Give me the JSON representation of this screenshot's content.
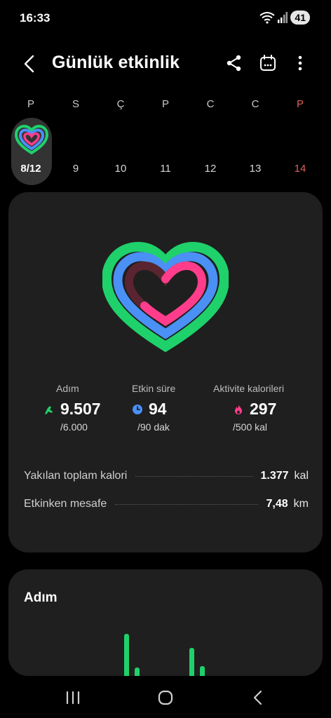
{
  "status_bar": {
    "time": "16:33",
    "battery": "41",
    "icons": [
      "wifi-icon",
      "signal-icon"
    ]
  },
  "app_bar": {
    "title": "Günlük etkinlik",
    "actions": [
      "back-icon",
      "share-icon",
      "calendar-icon",
      "more-vert-icon"
    ]
  },
  "week": {
    "days": [
      {
        "name": "P",
        "num": "8/12",
        "selected": true
      },
      {
        "name": "S",
        "num": "9"
      },
      {
        "name": "Ç",
        "num": "10"
      },
      {
        "name": "P",
        "num": "11"
      },
      {
        "name": "C",
        "num": "12"
      },
      {
        "name": "C",
        "num": "13"
      },
      {
        "name": "P",
        "num": "14",
        "sunday": true
      }
    ]
  },
  "summary": {
    "steps": {
      "label": "Adım",
      "value": "9.507",
      "goal": "/6.000",
      "color": "#1fd16b",
      "icon": "shoe-icon"
    },
    "active": {
      "label": "Etkin süre",
      "value": "94",
      "goal": "/90 dak",
      "color": "#4a90f5",
      "icon": "clock-icon"
    },
    "calories": {
      "label": "Aktivite kalorileri",
      "value": "297",
      "goal": "/500 kal",
      "color": "#ff3d8b",
      "icon": "flame-icon"
    },
    "rings": {
      "steps_progress": 1.0,
      "active_progress": 1.0,
      "calories_progress": 0.59
    }
  },
  "details": [
    {
      "label": "Yakılan toplam kalori",
      "value": "1.377",
      "unit": "kal"
    },
    {
      "label": "Etkinken mesafe",
      "value": "7,48",
      "unit": "km"
    }
  ],
  "steps_card": {
    "title": "Adım"
  },
  "nav": [
    "recent-apps-icon",
    "home-icon",
    "back-icon"
  ]
}
